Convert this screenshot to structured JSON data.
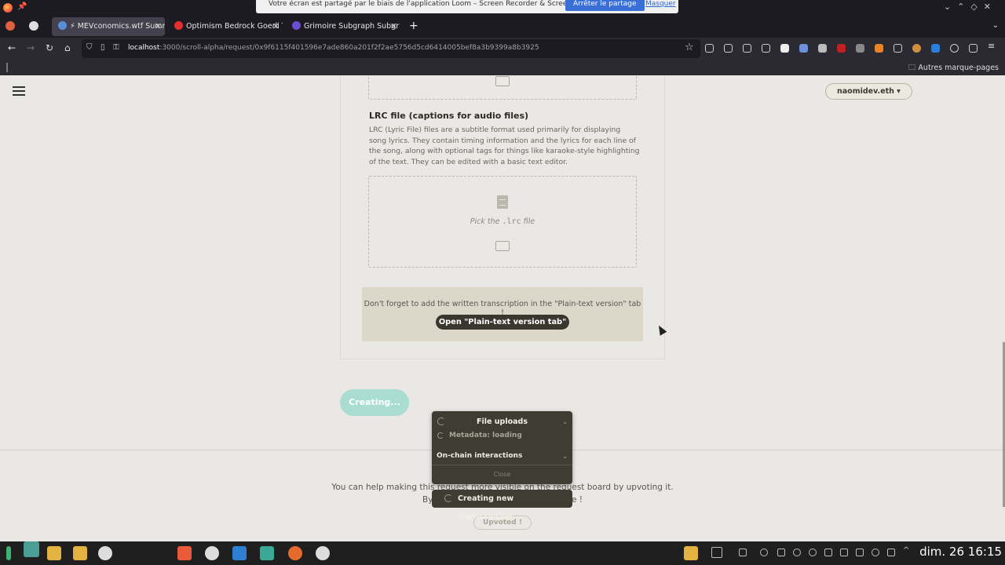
{
  "browser": {
    "share_notice": "Votre écran est partagé par le biais de l'application Loom – Screen Recorder & Screen Capture.",
    "share_stop": "Arrêter le partage",
    "share_hide": "Masquer",
    "tabs": [
      {
        "label": "⚡ MEVconomics.wtf Summ",
        "active": true
      },
      {
        "label": "Optimism Bedrock Goerli T",
        "active": false
      },
      {
        "label": "Grimoire Subgraph Subgr",
        "active": false
      }
    ],
    "url_host": "localhost",
    "url_rest": ":3000/scroll-alpha/request/0x9f6115f401596e7ade860a201f2f2ae5756d5cd6414005bef8a3b9399a8b3925",
    "bookmarks_other": "Autres marque-pages"
  },
  "header": {
    "account": "naomidev.eth ▾"
  },
  "lrc": {
    "title": "LRC file (captions for audio files)",
    "description": "LRC (Lyric File) files are a subtitle format used primarily for displaying song lyrics. They contain timing information and the lyrics for each line of the song, along with optional tags for things like karaoke-style highlighting of the text. They can be edited with a basic text editor.",
    "pick_prefix": "Pick the",
    "pick_ext": ".lrc",
    "pick_suffix": "file"
  },
  "notice": {
    "text": "Don't forget to add the written transcription in the \"Plain-text version\" tab !",
    "button": "Open \"Plain-text version tab\""
  },
  "form": {
    "creating_button": "Creating..."
  },
  "footer": {
    "line1": "You can help making this request more visible on the request board by upvoting it.",
    "line2_prefix": "By",
    "line2_suffix": "e !",
    "upvoted": "Upvoted !"
  },
  "modal": {
    "file_uploads": "File uploads",
    "metadata": "Metadata: loading",
    "onchain": "On-chain interactions",
    "close": "Close"
  },
  "toast": {
    "text": "Creating new transcription..."
  },
  "taskbar": {
    "clock": "dim. 26 16:15"
  }
}
